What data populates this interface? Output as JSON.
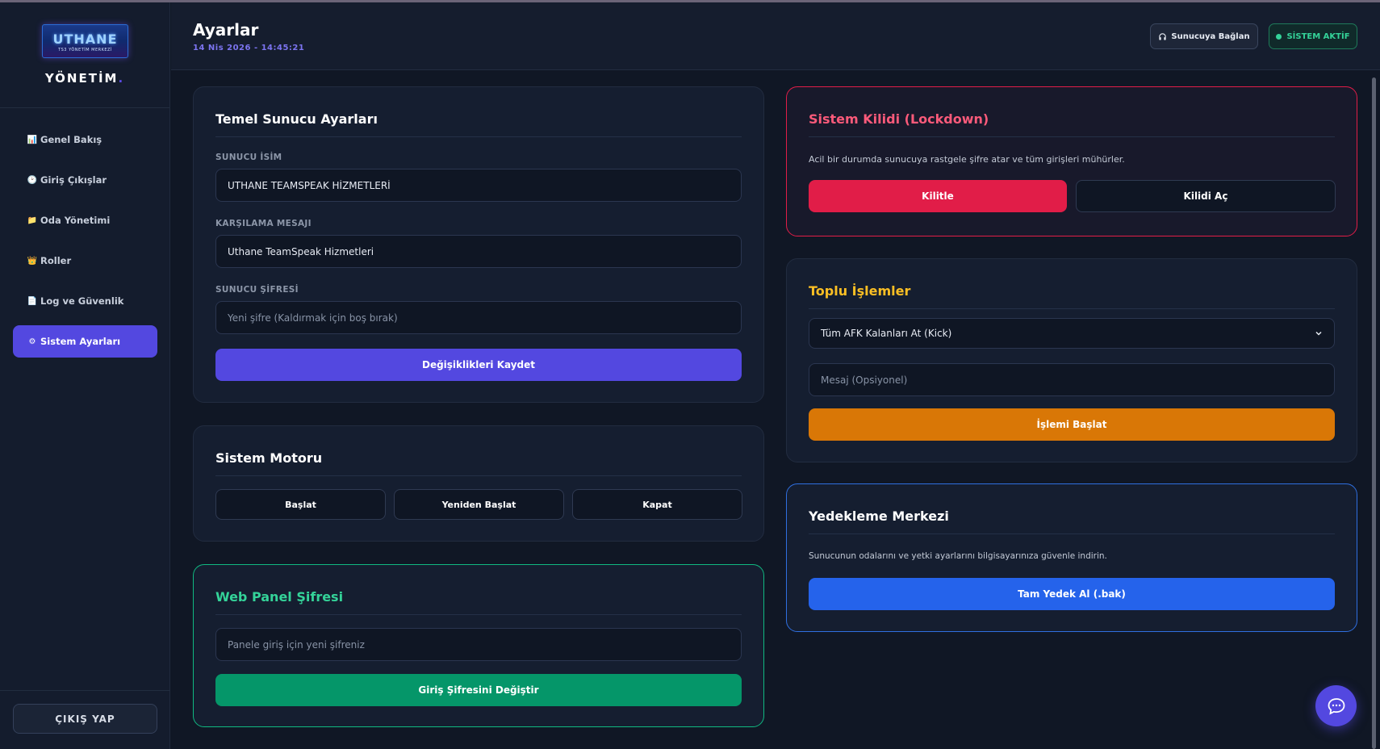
{
  "brand": {
    "logo_text": "UTHANE",
    "logo_subtext": "TS3 YÖNETİM MERKEZİ",
    "title": "YÖNETİM",
    "title_dot": "."
  },
  "sidebar": {
    "items": [
      {
        "icon": "📊",
        "label": "Genel Bakış"
      },
      {
        "icon": "🕑",
        "label": "Giriş Çıkışlar"
      },
      {
        "icon": "📁",
        "label": "Oda Yönetimi"
      },
      {
        "icon": "👑",
        "label": "Roller"
      },
      {
        "icon": "📄",
        "label": "Log ve Güvenlik"
      },
      {
        "icon": "⚙",
        "label": "Sistem Ayarları"
      }
    ],
    "active_index": 5,
    "logout_label": "ÇIKIŞ YAP"
  },
  "header": {
    "title": "Ayarlar",
    "datetime": "14 Nis 2026 - 14:45:21",
    "connect_label": "Sunucuya Bağlan",
    "status_label": "SİSTEM AKTİF"
  },
  "server_settings": {
    "title": "Temel Sunucu Ayarları",
    "name_label": "SUNUCU İSİM",
    "name_value": "UTHANE TEAMSPEAK HİZMETLERİ",
    "welcome_label": "KARŞILAMA MESAJI",
    "welcome_value": "Uthane TeamSpeak Hizmetleri",
    "password_label": "SUNUCU ŞİFRESİ",
    "password_placeholder": "Yeni şifre (Kaldırmak için boş bırak)",
    "save_label": "Değişiklikleri Kaydet"
  },
  "engine": {
    "title": "Sistem Motoru",
    "start_label": "Başlat",
    "restart_label": "Yeniden Başlat",
    "stop_label": "Kapat"
  },
  "web_panel": {
    "title": "Web Panel Şifresi",
    "password_placeholder": "Panele giriş için yeni şifreniz",
    "change_label": "Giriş Şifresini Değiştir"
  },
  "lockdown": {
    "title": "Sistem Kilidi (Lockdown)",
    "description": "Acil bir durumda sunucuya rastgele şifre atar ve tüm girişleri mühürler.",
    "lock_label": "Kilitle",
    "unlock_label": "Kilidi Aç"
  },
  "bulk": {
    "title": "Toplu İşlemler",
    "selected_option": "Tüm AFK Kalanları At (Kick)",
    "message_placeholder": "Mesaj (Opsiyonel)",
    "start_label": "İşlemi Başlat"
  },
  "backup": {
    "title": "Yedekleme Merkezi",
    "description": "Sunucunun odalarını ve yetki ayarlarını bilgisayarınıza güvenle indirin.",
    "download_label": "Tam Yedek Al (.bak)"
  },
  "colors": {
    "primary": "#5348e0",
    "danger": "#e11d48",
    "warning": "#d97706",
    "success": "#059669",
    "info": "#2563eb"
  }
}
